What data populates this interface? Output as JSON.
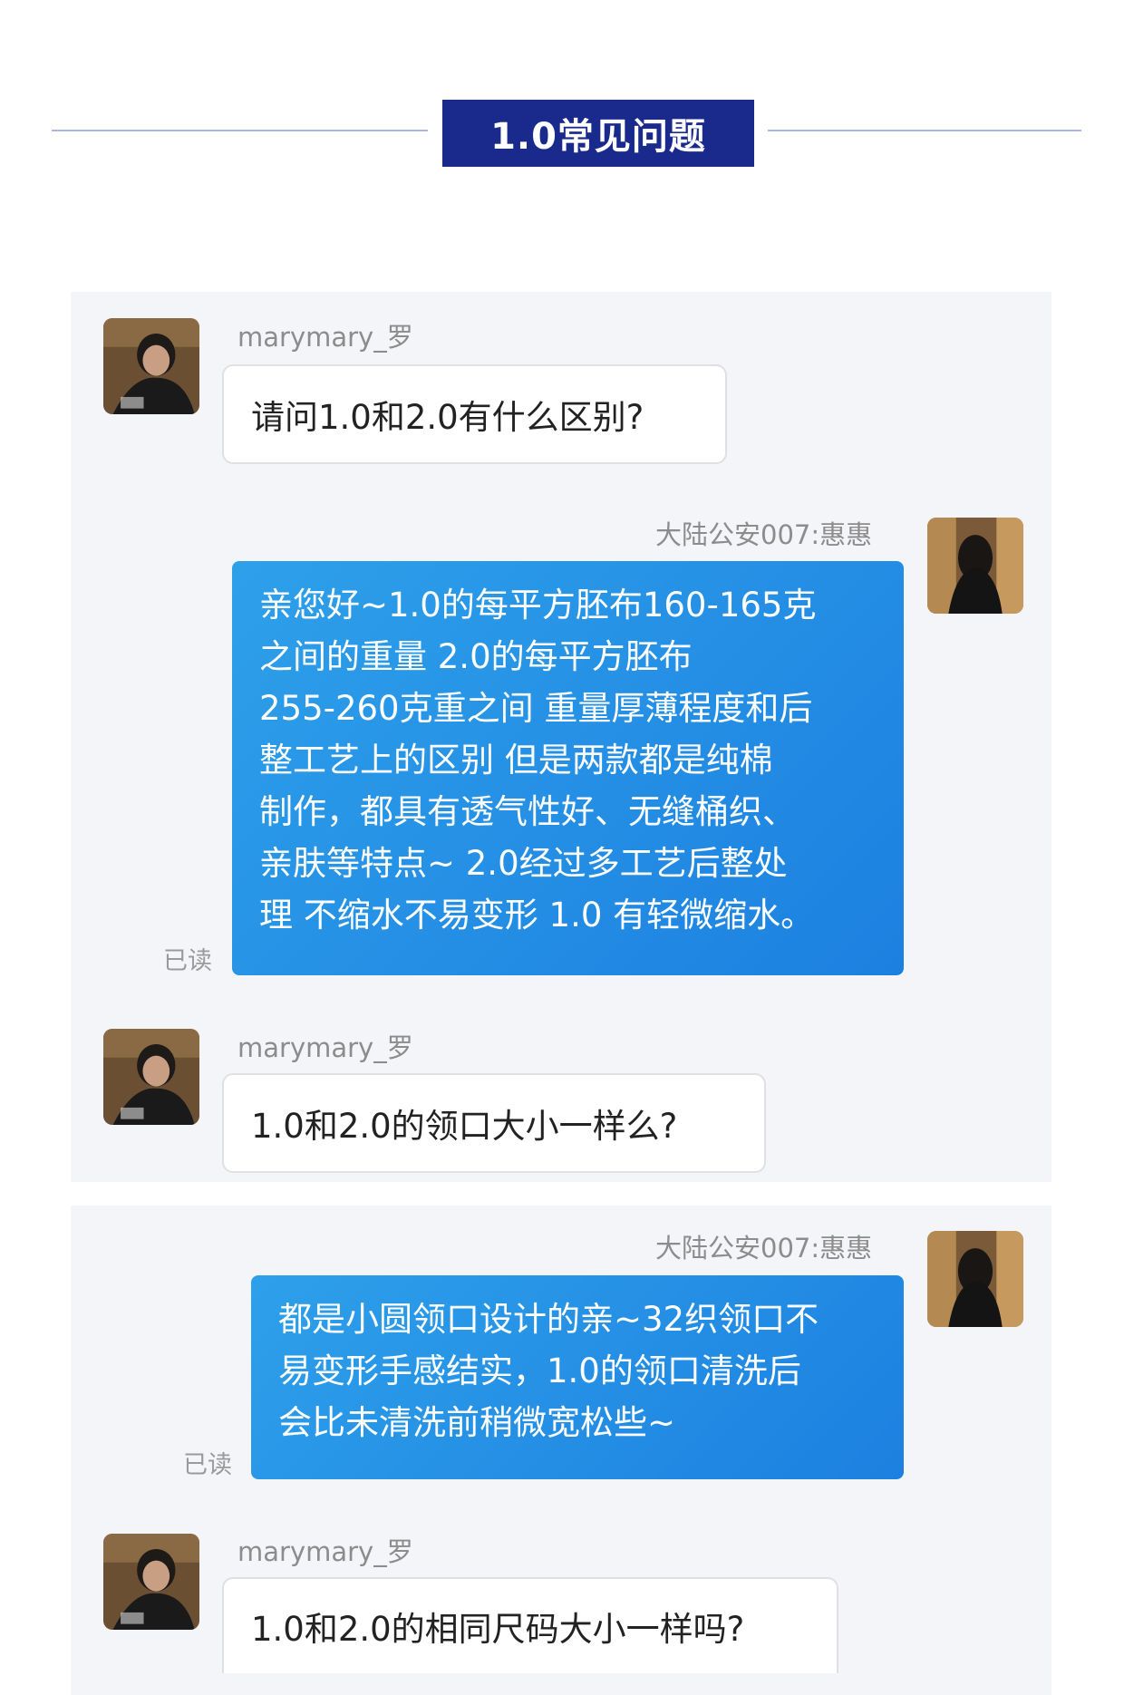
{
  "header": {
    "title": "1.0常见问题"
  },
  "conversation_1": {
    "msg1": {
      "sender": "marymary_罗",
      "text": "请问1.0和2.0有什么区别?"
    },
    "msg2": {
      "sender": "大陆公安007:惠惠",
      "lines": [
        "亲您好~1.0的每平方胚布160-165克",
        "之间的重量 2.0的每平方胚布",
        "255-260克重之间 重量厚薄程度和后",
        "整工艺上的区别 但是两款都是纯棉",
        "制作，都具有透气性好、无缝桶织、",
        "亲肤等特点~   2.0经过多工艺后整处",
        "理 不缩水不易变形 1.0 有轻微缩水。"
      ],
      "status": "已读"
    },
    "msg3": {
      "sender": "marymary_罗",
      "text": "1.0和2.0的领口大小一样么?"
    }
  },
  "conversation_2": {
    "msg1": {
      "sender": "大陆公安007:惠惠",
      "lines": [
        "都是小圆领口设计的亲~32织领口不",
        "易变形手感结实，1.0的领口清洗后",
        "会比未清洗前稍微宽松些~"
      ],
      "status": "已读"
    },
    "msg2": {
      "sender": "marymary_罗",
      "text": "1.0和2.0的相同尺码大小一样吗?"
    }
  },
  "colors": {
    "title_bg": "#1a2a8c",
    "outgoing_bubble": "#1f8ce6",
    "panel_bg": "#f4f5f8"
  }
}
